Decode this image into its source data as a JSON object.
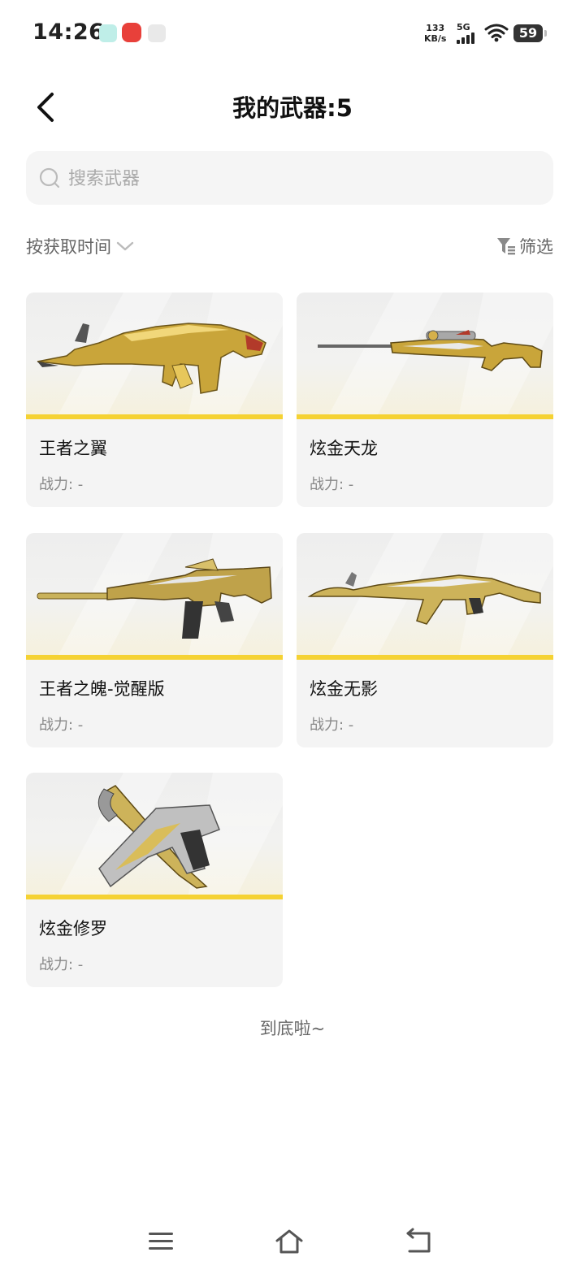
{
  "status_bar": {
    "time": "14:26",
    "net_speed_value": "133",
    "net_speed_unit": "KB/s",
    "network": "5G",
    "battery": "59"
  },
  "header": {
    "title": "我的武器:5"
  },
  "search": {
    "placeholder": "搜索武器"
  },
  "sort": {
    "label": "按获取时间"
  },
  "filter": {
    "label": "筛选"
  },
  "weapons": [
    {
      "name": "王者之翼",
      "power": "战力: -",
      "icon": "assault-rifle-gold"
    },
    {
      "name": "炫金天龙",
      "power": "战力: -",
      "icon": "sniper-rifle-gold"
    },
    {
      "name": "王者之魄-觉醒版",
      "power": "战力: -",
      "icon": "m4-rifle-gold"
    },
    {
      "name": "炫金无影",
      "power": "战力: -",
      "icon": "ak-rifle-gold"
    },
    {
      "name": "炫金修罗",
      "power": "战力: -",
      "icon": "pistol-knife-gold"
    }
  ],
  "footer": {
    "end_text": "到底啦~"
  },
  "colors": {
    "accent_stripe": "#f5d233",
    "card_bg": "#f4f4f4",
    "search_bg": "#f5f5f5"
  }
}
